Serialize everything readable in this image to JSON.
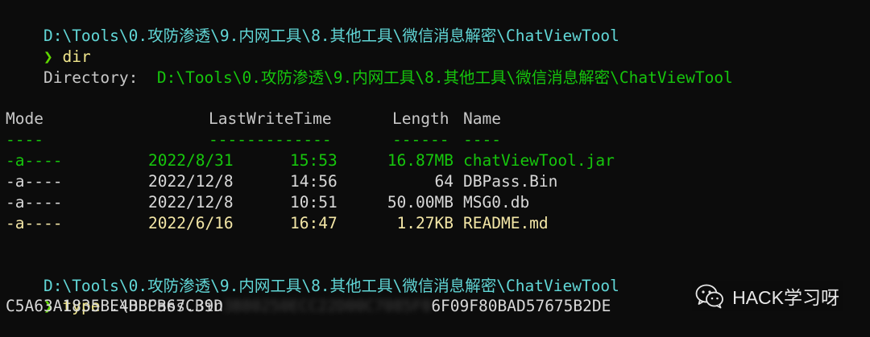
{
  "prompt_symbol": "❯",
  "block1": {
    "path": "D:\\Tools\\0.攻防渗透\\9.内网工具\\8.其他工具\\微信消息解密\\ChatViewTool",
    "command": "dir"
  },
  "listing": {
    "directory_label": "Directory:",
    "directory_path": "D:\\Tools\\0.攻防渗透\\9.内网工具\\8.其他工具\\微信消息解密\\ChatViewTool",
    "headers": {
      "mode": "Mode",
      "lastwritetime": "LastWriteTime",
      "length": "Length",
      "name": "Name"
    },
    "separators": {
      "mode": "----",
      "lastwritetime": "-------------",
      "length": "------",
      "name": "----"
    },
    "files": [
      {
        "mode": "-a----",
        "date": "2022/8/31",
        "time": "15:53",
        "length": "16.87MB",
        "name": "chatViewTool.jar",
        "color": "#16c60c"
      },
      {
        "mode": "-a----",
        "date": "2022/12/8",
        "time": "14:56",
        "length": "64",
        "name": "DBPass.Bin",
        "color": "#d8d8d8"
      },
      {
        "mode": "-a----",
        "date": "2022/12/8",
        "time": "10:51",
        "length": "50.00MB",
        "name": "MSG0.db",
        "color": "#d8d8d8"
      },
      {
        "mode": "-a----",
        "date": "2022/6/16",
        "time": "16:47",
        "length": "1.27KB",
        "name": "README.md",
        "color": "#f3e6a6"
      }
    ]
  },
  "block2": {
    "path": "D:\\Tools\\0.攻防渗透\\9.内网工具\\8.其他工具\\微信消息解密\\ChatViewTool",
    "command": "type",
    "argument": ".\\DBPass.Bin"
  },
  "output": {
    "hash_visible_start": "C5A63A1835BE4BBCB67C39D",
    "hash_redacted": "3B80250ECC22D00C7085F0",
    "hash_visible_end": "6F09F80BAD57675B2DE"
  },
  "watermark": {
    "icon": "wechat-icon",
    "text": "HACK学习呀"
  }
}
